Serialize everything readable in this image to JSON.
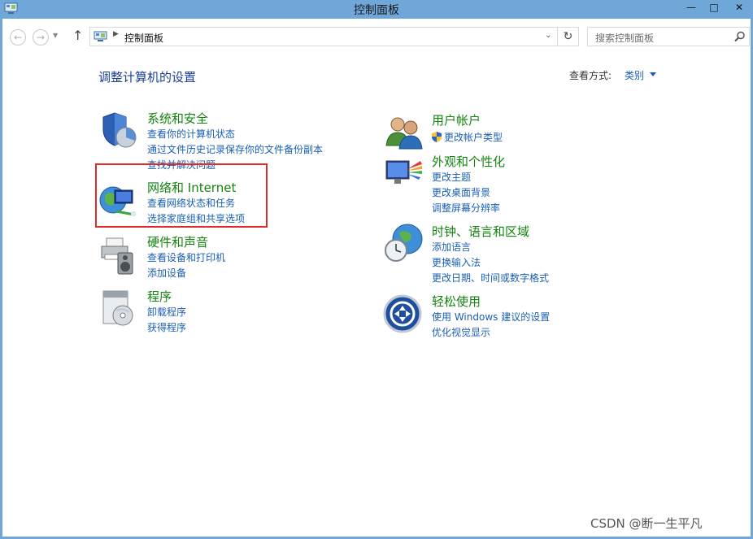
{
  "window": {
    "title": "控制面板",
    "controls": {
      "minimize": "—",
      "maximize": "□",
      "close": "✕"
    }
  },
  "nav": {
    "back_icon": "back-arrow-icon",
    "forward_icon": "forward-arrow-icon",
    "up_icon": "up-arrow-icon",
    "address": "控制面板",
    "search_placeholder": "搜索控制面板"
  },
  "header": {
    "title": "调整计算机的设置",
    "view_by_label": "查看方式:",
    "view_by_value": "类别"
  },
  "categories_left": [
    {
      "title": "系统和安全",
      "icon": "shield-pie-icon",
      "links": [
        "查看你的计算机状态",
        "通过文件历史记录保存你的文件备份副本",
        "查找并解决问题"
      ]
    },
    {
      "title": "网络和 Internet",
      "icon": "network-globe-icon",
      "links": [
        "查看网络状态和任务",
        "选择家庭组和共享选项"
      ]
    },
    {
      "title": "硬件和声音",
      "icon": "printer-speaker-icon",
      "links": [
        "查看设备和打印机",
        "添加设备"
      ]
    },
    {
      "title": "程序",
      "icon": "programs-disc-icon",
      "links": [
        "卸载程序",
        "获得程序"
      ]
    }
  ],
  "categories_right": [
    {
      "title": "用户帐户",
      "icon": "users-icon",
      "links": [
        "更改帐户类型"
      ]
    },
    {
      "title": "外观和个性化",
      "icon": "monitor-palette-icon",
      "links": [
        "更改主题",
        "更改桌面背景",
        "调整屏幕分辨率"
      ]
    },
    {
      "title": "时钟、语言和区域",
      "icon": "clock-globe-icon",
      "links": [
        "添加语言",
        "更换输入法",
        "更改日期、时间或数字格式"
      ]
    },
    {
      "title": "轻松使用",
      "icon": "ease-of-access-icon",
      "links": [
        "使用 Windows 建议的设置",
        "优化视觉显示"
      ]
    }
  ],
  "watermark": "CSDN @断一生平凡",
  "colors": {
    "title_bar": "#6fa7d9",
    "category_title": "#12850f",
    "link": "#1a5fb4",
    "page_title": "#1b3e91",
    "highlight_box": "#e02b2b"
  }
}
